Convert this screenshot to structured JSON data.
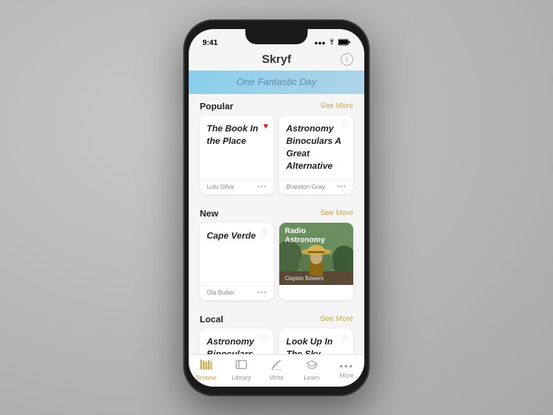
{
  "phone": {
    "status_time": "9:41",
    "status_signal": "●●●",
    "status_wifi": "WiFi",
    "status_battery": "Battery"
  },
  "app": {
    "title": "Skryf",
    "info_label": "i",
    "banner_text": "One Fantastic Day"
  },
  "sections": [
    {
      "id": "popular",
      "label": "Popular",
      "see_more": "See More",
      "books": [
        {
          "title": "The Book In the Place",
          "heart": "red",
          "author": "Lulu Silva",
          "has_image": false
        },
        {
          "title": "Astronomy Binoculars A Great Alternative",
          "heart": "outline",
          "author": "Brandon Gray",
          "has_image": false
        }
      ]
    },
    {
      "id": "new",
      "label": "New",
      "see_more": "See More",
      "books": [
        {
          "title": "Cape Verde",
          "heart": "outline",
          "author": "Ola Butler",
          "has_image": false
        },
        {
          "title": "Radio Astronomy",
          "author": "Clayton Bowers",
          "has_image": true
        }
      ]
    },
    {
      "id": "local",
      "label": "Local",
      "see_more": "See More",
      "books": [
        {
          "title": "Astronomy Binoculars",
          "heart": "outline",
          "author": "",
          "has_image": false,
          "truncated": true
        },
        {
          "title": "Look Up In The Sky",
          "heart": "outline",
          "author": "",
          "has_image": false,
          "truncated": true
        }
      ]
    }
  ],
  "tabs": [
    {
      "id": "browse",
      "label": "Browse",
      "active": true,
      "icon": "browse"
    },
    {
      "id": "library",
      "label": "Library",
      "active": false,
      "icon": "library"
    },
    {
      "id": "write",
      "label": "Write",
      "active": false,
      "icon": "write"
    },
    {
      "id": "learn",
      "label": "Learn",
      "active": false,
      "icon": "learn"
    },
    {
      "id": "more",
      "label": "More",
      "active": false,
      "icon": "more"
    }
  ],
  "colors": {
    "active_tab": "#c8a84b",
    "inactive_tab": "#999999",
    "accent": "#c8a84b"
  }
}
